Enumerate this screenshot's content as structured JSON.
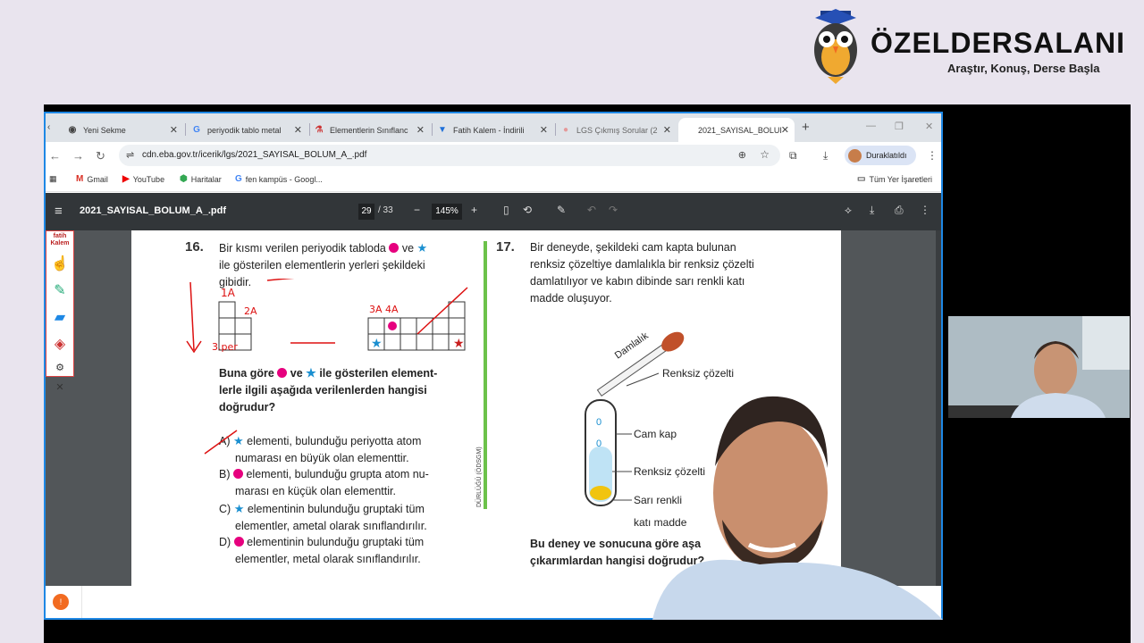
{
  "brand": {
    "name": "ÖZELDERSALANI",
    "tagline": "Araştır, Konuş, Derse Başla"
  },
  "browser": {
    "tabs": [
      {
        "label": "Yeni Sekme",
        "icon": "chrome-icon"
      },
      {
        "label": "periyodik tablo metal",
        "icon": "google-icon"
      },
      {
        "label": "Elementlerin Sınıflanc",
        "icon": "flask-icon"
      },
      {
        "label": "Fatih Kalem - İndirili",
        "icon": "triangle-icon"
      },
      {
        "label": "LGS Çıkmış Sorular (2",
        "icon": "circle-icon"
      },
      {
        "label": "2021_SAYISAL_BOLUI",
        "icon": "pdf-icon",
        "active": true
      }
    ],
    "url": "cdn.eba.gov.tr/icerik/lgs/2021_SAYISAL_BOLUM_A_.pdf",
    "profile_label": "Duraklatıldı",
    "bookmarks": [
      {
        "label": "Gmail",
        "icon": "gmail-icon"
      },
      {
        "label": "YouTube",
        "icon": "youtube-icon"
      },
      {
        "label": "Haritalar",
        "icon": "maps-icon"
      },
      {
        "label": "fen kampüs - Googl...",
        "icon": "google-icon"
      }
    ],
    "all_bookmarks_label": "Tüm Yer İşaretleri"
  },
  "pdf": {
    "filename": "2021_SAYISAL_BOLUM_A_.pdf",
    "page_current": "29",
    "page_total": "/ 33",
    "zoom": "145%"
  },
  "q16": {
    "number": "16.",
    "stem_1": "Bir kısmı verilen periyodik tabloda",
    "stem_1b": "ve",
    "stem_2": "ile gösterilen elementlerin yerleri şekildeki",
    "stem_3": "gibidir.",
    "ask_1a": "Buna göre",
    "ask_1b": "ve",
    "ask_1c": "ile gösterilen element-",
    "ask_2": "lerle ilgili aşağıda verilenlerden hangisi",
    "ask_3": "doğrudur?",
    "options": [
      {
        "letter": "A)",
        "line1": "elementi, bulunduğu periyotta atom",
        "line2": "numarası en büyük olan elementtir."
      },
      {
        "letter": "B)",
        "line1": "elementi, bulunduğu grupta atom nu-",
        "line2": "marası en küçük olan elementtir."
      },
      {
        "letter": "C)",
        "line1": "elementinin bulunduğu gruptaki tüm",
        "line2": "elementler, ametal olarak sınıflandırılır."
      },
      {
        "letter": "D)",
        "line1": "elementinin bulunduğu gruptaki tüm",
        "line2": "elementler, metal olarak sınıflandırılır."
      }
    ],
    "handwriting": {
      "a": "1A",
      "b": "2A",
      "c": "3A 4A",
      "d": "3.per"
    }
  },
  "q17": {
    "number": "17.",
    "lines": [
      "Bir deneyde, şekildeki cam kapta bulunan",
      "renksiz çözeltiye damlalıkla bir renksiz çözelti",
      "damlatılıyor ve kabın dibinde sarı renkli katı",
      "madde oluşuyor."
    ],
    "labels": {
      "dropper": "Damlalık",
      "colorless_top": "Renksiz çözelti",
      "glass": "Cam kap",
      "colorless_mid": "Renksiz çözelti",
      "solid_1": "Sarı renkli",
      "solid_2": "katı madde"
    },
    "ask_1": "Bu deney ve sonucuna göre aşa",
    "ask_2": "çıkarımlardan hangisi doğrudur?"
  },
  "side_label": "DÜRLÜĞÜ (ÖDSGM)",
  "colors": {
    "accent": "#1e88e5",
    "pink": "#e6007e",
    "green": "#6cc24a",
    "pdf_bar": "#323639"
  }
}
